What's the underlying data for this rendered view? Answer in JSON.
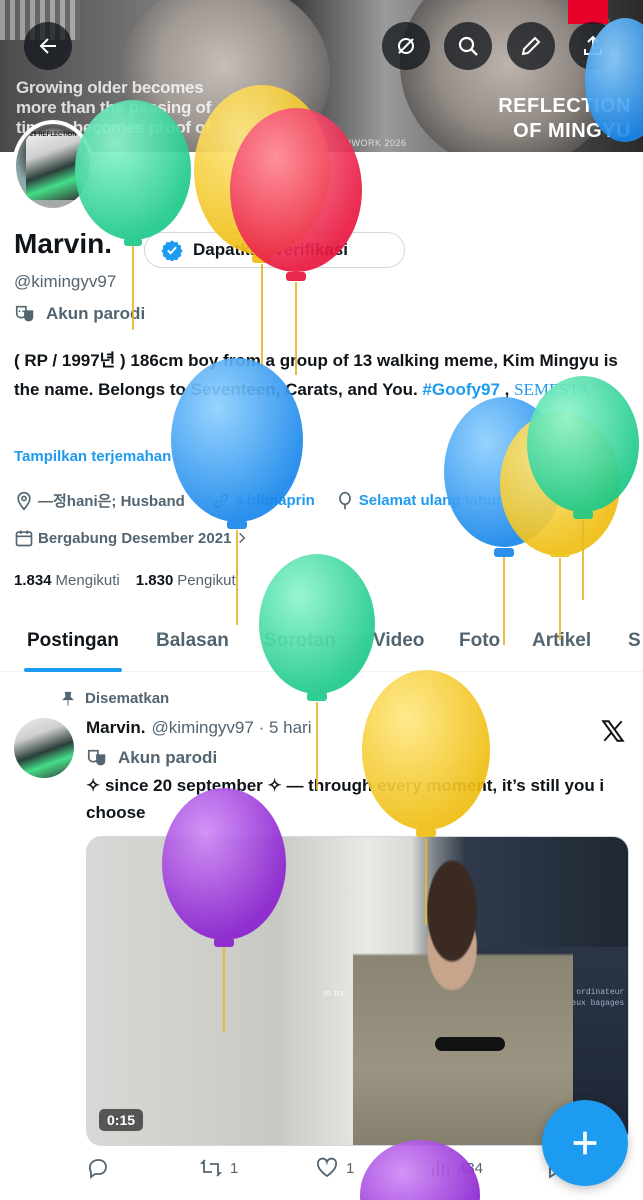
{
  "header": {
    "banner_text_left": "Growing older becomes more than the passing of time, it becomes proof of",
    "banner_text_right_1": "REFLECTION",
    "banner_text_right_2": "OF MINGYU",
    "banner_small_1": "AL",
    "banner_small_2": "YUWORK 2026",
    "back_icon": "arrow-left-icon",
    "buttons": [
      "no-sound-icon",
      "search-icon",
      "edit-icon",
      "share-icon"
    ]
  },
  "profile": {
    "avatar_text": "29 REFLECTION",
    "name": "Marvin.",
    "verify_label": "Dapatkan verifikasi",
    "handle": "@kimingyv97",
    "parody_label": "Akun parodi",
    "bio_main": "( RP / 1997년 ) 186cm boy from a group of 13 walking meme, Kim Mingyu is the name. Belongs to Seventeen, Carats, and You. ",
    "bio_tag": "#Goofy97",
    "bio_sep": " , ",
    "bio_semesta": "SEMESTA",
    "translate_label": "Tampilkan terjemahan",
    "location": "—정hani은; Husband",
    "link": "s.id/maprin",
    "birthday": "Selamat ulang tahun!",
    "joined": "Bergabung Desember 2021",
    "following_count": "1.834",
    "following_label": "Mengikuti",
    "followers_count": "1.830",
    "followers_label": "Pengikut"
  },
  "tabs": [
    "Postingan",
    "Balasan",
    "Sorotan",
    "Video",
    "Foto",
    "Artikel",
    "S"
  ],
  "post": {
    "pinned_label": "Disematkan",
    "name": "Marvin.",
    "handle": "@kimingyv97",
    "dot": "·",
    "time": "5 hari",
    "parody_label": "Akun parodi",
    "text": "✧ since 20 september ✧ — through every moment, it’s still you i choose",
    "video_duration": "0:15",
    "video_subtitle": "m tre",
    "video_wall_text": "Ne connecter votre ordinateur bagages sur les lieux bagages",
    "replies": "",
    "reposts": "1",
    "likes": "1",
    "views": "434"
  },
  "colors": {
    "accent": "#1d9bf0",
    "text": "#0f1419",
    "muted": "#536471",
    "balloon_green": "#3fe0a4",
    "balloon_yellow": "#f5cd2a",
    "balloon_red": "#f23a5a",
    "balloon_blue": "#2f9cf4",
    "balloon_purple": "#a03ee0"
  }
}
